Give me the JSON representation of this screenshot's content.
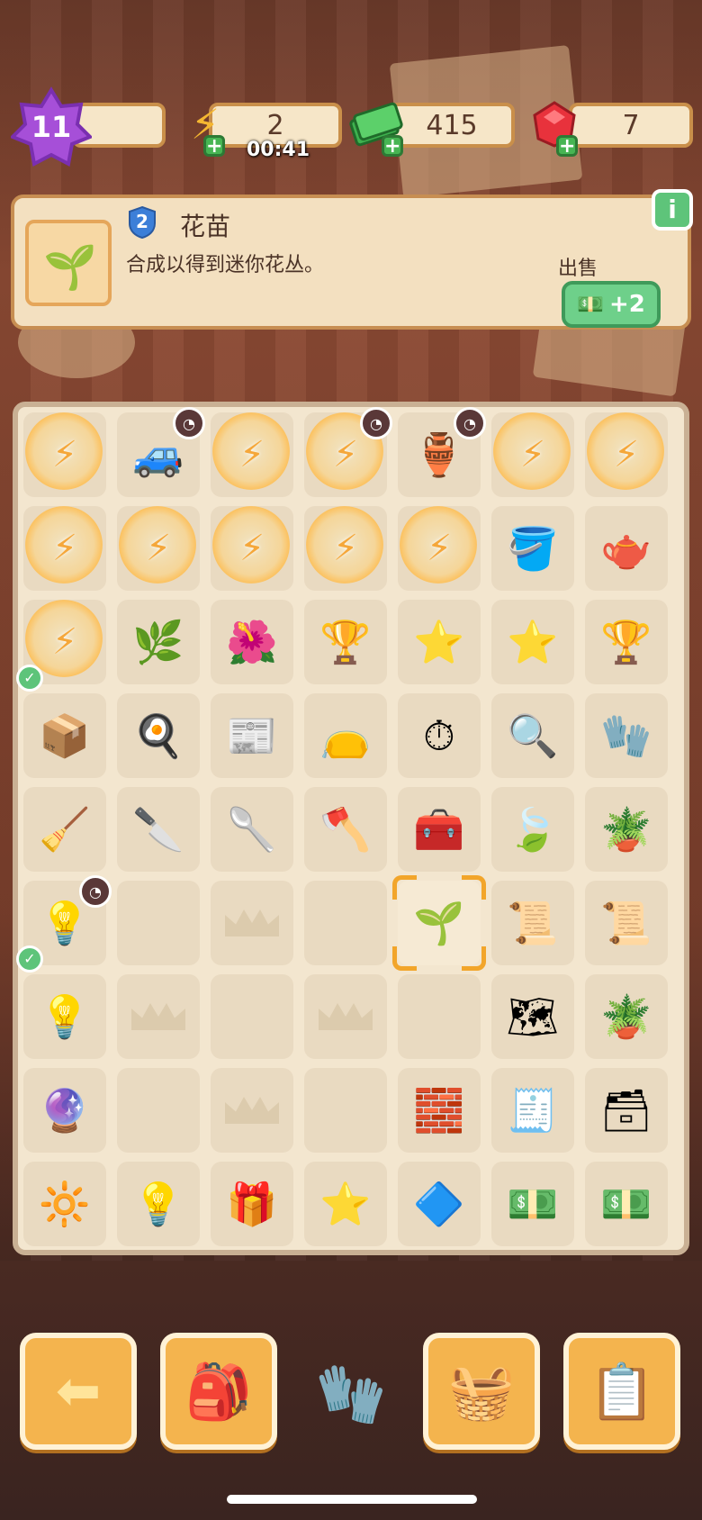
{
  "top_bar": {
    "level": "11",
    "energy": "2",
    "energy_timer": "00:41",
    "cash": "415",
    "gems": "7"
  },
  "info_panel": {
    "item_level": "2",
    "item_name": "花苗",
    "item_desc": "合成以得到迷你花丛。",
    "sell_label": "出售",
    "sell_value": "+2",
    "info_button": "i"
  },
  "board": {
    "rows": [
      [
        {
          "icon": "⚡",
          "locked": true
        },
        {
          "icon": "🚙",
          "timer": true
        },
        {
          "icon": "⚡",
          "locked": true
        },
        {
          "icon": "⚡",
          "locked": true,
          "timer": true
        },
        {
          "icon": "🏺",
          "timer": true
        },
        {
          "icon": "⚡",
          "locked": true
        },
        {
          "icon": "⚡",
          "locked": true
        }
      ],
      [
        {
          "icon": "⚡",
          "locked": true
        },
        {
          "icon": "⚡",
          "locked": true
        },
        {
          "icon": "⚡",
          "locked": true
        },
        {
          "icon": "⚡",
          "locked": true
        },
        {
          "icon": "⚡",
          "locked": true
        },
        {
          "icon": "🪣"
        },
        {
          "icon": "🫖"
        }
      ],
      [
        {
          "icon": "⚡",
          "locked": true,
          "check": true
        },
        {
          "icon": "🌿"
        },
        {
          "icon": "🌺"
        },
        {
          "icon": "🏆"
        },
        {
          "icon": "⭐"
        },
        {
          "icon": "⭐"
        },
        {
          "icon": "🏆"
        }
      ],
      [
        {
          "icon": "📦"
        },
        {
          "icon": "🍳"
        },
        {
          "icon": "📰"
        },
        {
          "icon": "👝"
        },
        {
          "icon": "⏱"
        },
        {
          "icon": "🔍"
        },
        {
          "icon": "🧤"
        }
      ],
      [
        {
          "icon": "🧹"
        },
        {
          "icon": "🔪"
        },
        {
          "icon": "🥄"
        },
        {
          "icon": "🪓"
        },
        {
          "icon": "🧰"
        },
        {
          "icon": "🍃"
        },
        {
          "icon": "🪴"
        }
      ],
      [
        {
          "icon": "💡",
          "timer": true,
          "check": true
        },
        {
          "empty": true
        },
        {
          "crown": true
        },
        {
          "empty": true
        },
        {
          "icon": "🌱",
          "selected": true
        },
        {
          "icon": "📜"
        },
        {
          "icon": "📜"
        }
      ],
      [
        {
          "icon": "💡"
        },
        {
          "crown": true
        },
        {
          "empty": true
        },
        {
          "crown": true
        },
        {
          "empty": true
        },
        {
          "icon": "🗺"
        },
        {
          "icon": "🪴"
        }
      ],
      [
        {
          "icon": "🔮"
        },
        {
          "empty": true
        },
        {
          "crown": true
        },
        {
          "empty": true
        },
        {
          "icon": "🧱"
        },
        {
          "icon": "🧾"
        },
        {
          "icon": "🗃"
        }
      ],
      [
        {
          "icon": "🔆"
        },
        {
          "icon": "💡"
        },
        {
          "icon": "🎁"
        },
        {
          "icon": "⭐"
        },
        {
          "icon": "🔷"
        },
        {
          "icon": "💵"
        },
        {
          "icon": "💵"
        }
      ]
    ]
  },
  "bottom_bar": {
    "back_icon": "⬅",
    "bag_icon": "🎒",
    "glove_icon": "🧤",
    "basket_icon": "🧺",
    "task_icon": "📋"
  }
}
